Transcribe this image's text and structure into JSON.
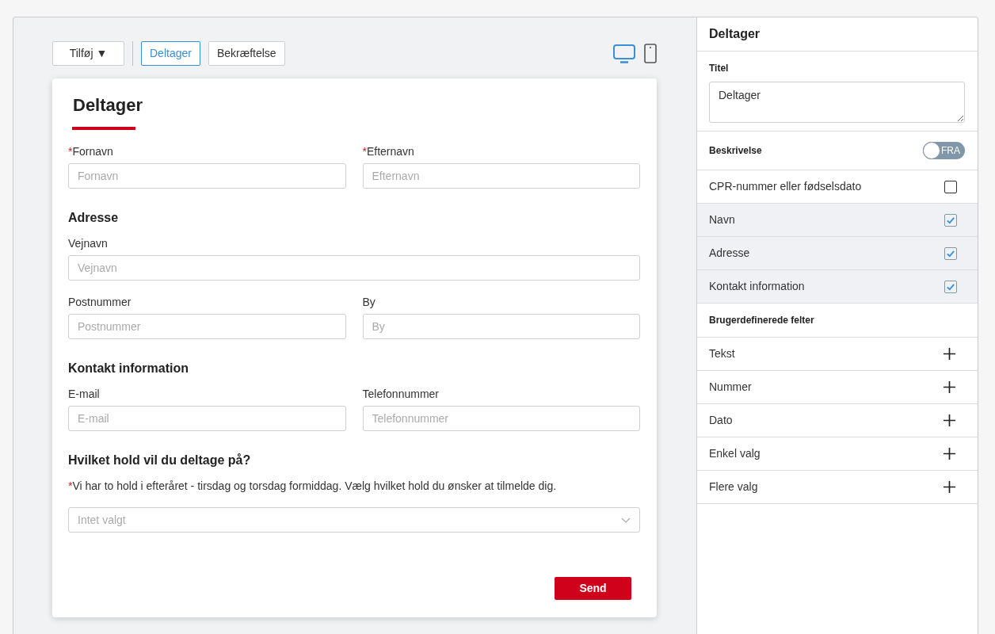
{
  "toolbar": {
    "add_label": "Tilføj ▼",
    "pages": [
      {
        "label": "Deltager",
        "selected": true
      },
      {
        "label": "Bekræftelse",
        "selected": false
      }
    ],
    "devices": [
      {
        "kind": "desktop",
        "selected": true
      },
      {
        "kind": "mobile",
        "selected": false
      }
    ]
  },
  "form": {
    "title": "Deltager",
    "required_mark": "*",
    "items": [
      {
        "kind": "fields",
        "fields": [
          {
            "label": "Fornavn",
            "required": true,
            "placeholder": "Fornavn"
          },
          {
            "label": "Efternavn",
            "required": true,
            "placeholder": "Efternavn"
          }
        ]
      },
      {
        "kind": "heading",
        "text": "Adresse"
      },
      {
        "kind": "fields",
        "fields": [
          {
            "label": "Vejnavn",
            "required": false,
            "placeholder": "Vejnavn"
          }
        ]
      },
      {
        "kind": "fields",
        "fields": [
          {
            "label": "Postnummer",
            "required": false,
            "placeholder": "Postnummer"
          },
          {
            "label": "By",
            "required": false,
            "placeholder": "By"
          }
        ]
      },
      {
        "kind": "heading",
        "text": "Kontakt information"
      },
      {
        "kind": "fields",
        "fields": [
          {
            "label": "E-mail",
            "required": false,
            "placeholder": "E-mail"
          },
          {
            "label": "Telefonnummer",
            "required": false,
            "placeholder": "Telefonnummer"
          }
        ]
      },
      {
        "kind": "heading",
        "text": "Hvilket hold vil du deltage på?"
      },
      {
        "kind": "select",
        "label": "Vi har to hold i efteråret - tirsdag og torsdag formiddag. Vælg hvilket hold du ønsker at tilmelde dig.",
        "required": true,
        "placeholder": "Intet valgt"
      }
    ],
    "submit_label": "Send"
  },
  "panel": {
    "title": "Deltager",
    "title_field": {
      "label": "Titel",
      "value": "Deltager"
    },
    "description": {
      "label": "Beskrivelse",
      "on": false,
      "state_text": "FRA"
    },
    "options": [
      {
        "label": "CPR-nummer eller fødselsdato",
        "checked": false
      },
      {
        "label": "Navn",
        "checked": true
      },
      {
        "label": "Adresse",
        "checked": true
      },
      {
        "label": "Kontakt information",
        "checked": true
      }
    ],
    "custom_fields": {
      "heading": "Brugerdefinerede felter",
      "items": [
        "Tekst",
        "Nummer",
        "Dato",
        "Enkel valg",
        "Flere valg"
      ]
    }
  }
}
